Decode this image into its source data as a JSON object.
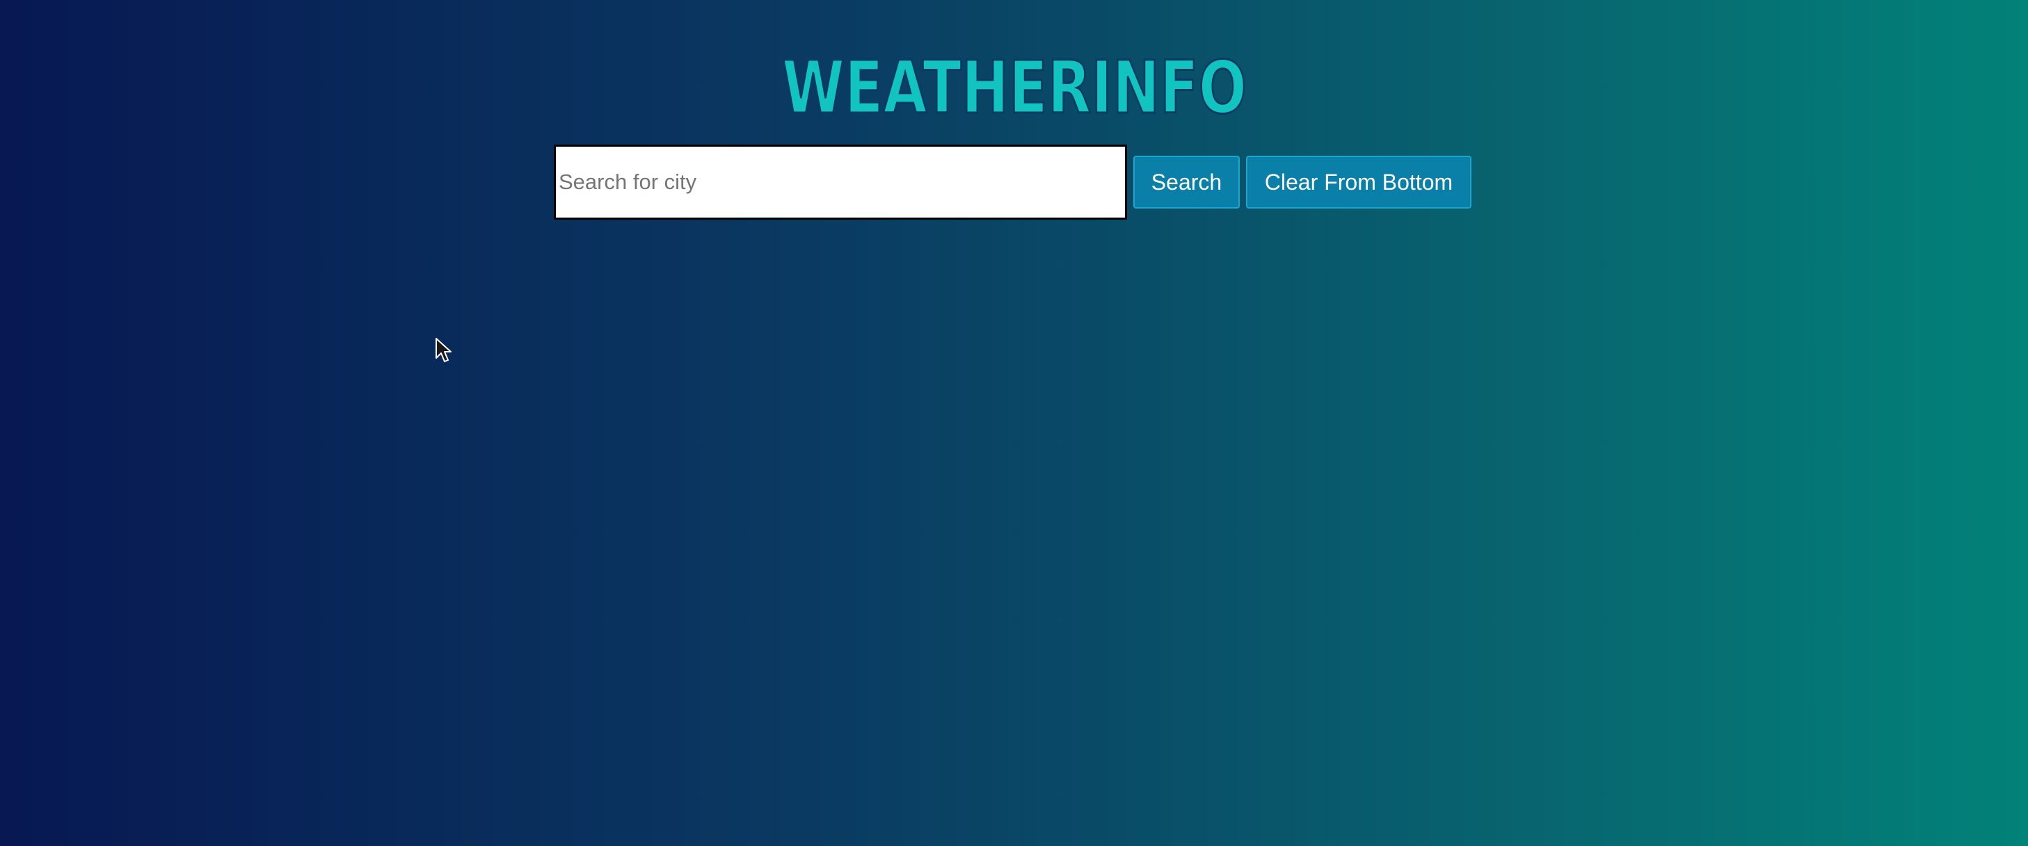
{
  "header": {
    "logo_text": "WEATHERINFO",
    "logo_color": "#12c4c0"
  },
  "search": {
    "placeholder": "Search for city",
    "value": "",
    "search_label": "Search",
    "clear_label": "Clear From Bottom"
  },
  "colors": {
    "background_start": "#071852",
    "background_end": "#028279",
    "button": "#0a7fa8"
  },
  "icons": {
    "cursor": "mouse-pointer-icon"
  }
}
